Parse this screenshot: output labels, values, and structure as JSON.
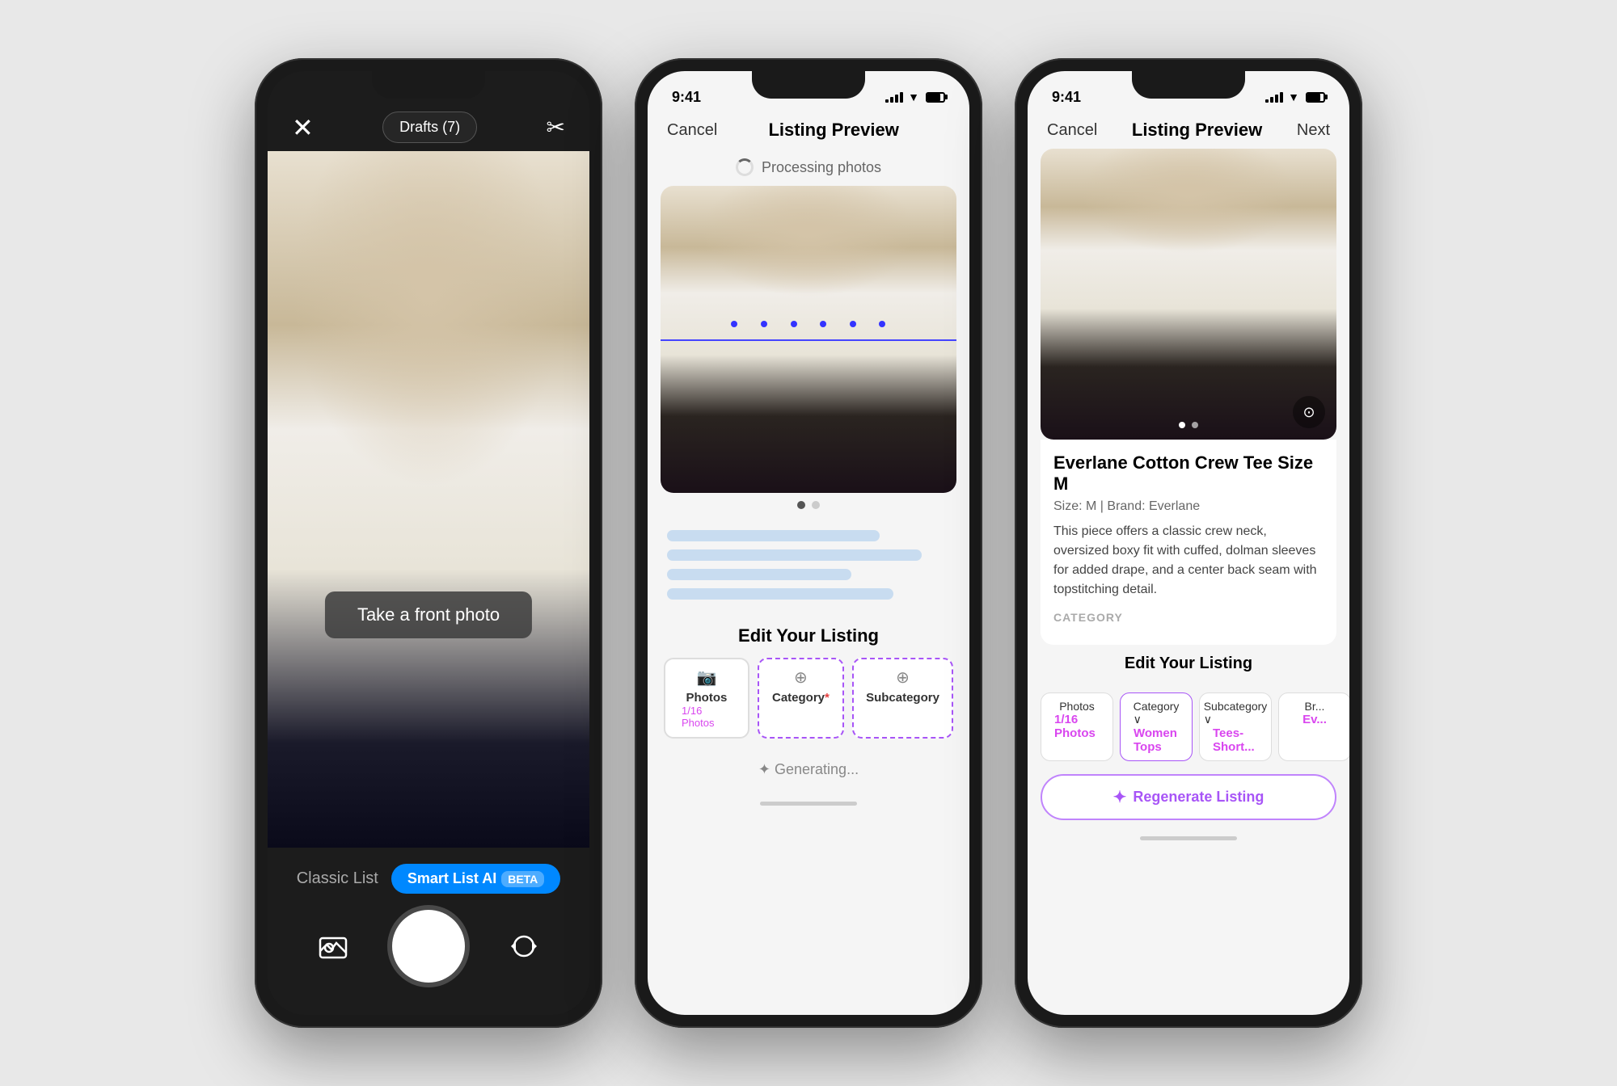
{
  "phones": {
    "phone1": {
      "drafts_btn": "Drafts (7)",
      "take_photo_label": "Take a front photo",
      "classic_list_label": "Classic List",
      "smart_list_label": "Smart List AI",
      "beta_label": "BETA"
    },
    "phone2": {
      "status_time": "9:41",
      "nav_cancel": "Cancel",
      "nav_title": "Listing Preview",
      "processing_label": "Processing photos",
      "edit_listing_title": "Edit Your Listing",
      "tabs": [
        {
          "icon": "📷",
          "label": "Photos",
          "sublabel": "1/16 Photos",
          "required": false,
          "active": false
        },
        {
          "icon": "⊕",
          "label": "Category",
          "sublabel": "",
          "required": true,
          "active": true
        },
        {
          "icon": "⊕",
          "label": "Subcategory",
          "sublabel": "",
          "required": false,
          "active": true
        }
      ],
      "generating_label": "✦  Generating..."
    },
    "phone3": {
      "status_time": "9:41",
      "nav_cancel": "Cancel",
      "nav_title": "Listing Preview",
      "nav_next": "Next",
      "listing_title": "Everlane Cotton Crew Tee Size M",
      "listing_meta": "Size: M  |  Brand: Everlane",
      "listing_description": "This piece offers a classic crew neck, oversized boxy fit with cuffed, dolman sleeves for added drape, and a center back seam with topstitching detail.",
      "category_header": "CATEGORY",
      "edit_listing_title": "Edit Your Listing",
      "tabs": [
        {
          "label": "Photos",
          "sublabel": "1/16 Photos",
          "value": "1/16 Photos",
          "active": false
        },
        {
          "label": "Category",
          "value": "Women Tops",
          "active": true
        },
        {
          "label": "Subcategory",
          "value": "Tees- Short...",
          "active": false
        },
        {
          "label": "Br...",
          "value": "Ev...",
          "active": false
        }
      ],
      "regen_label": "✦  Regenerate Listing"
    }
  }
}
